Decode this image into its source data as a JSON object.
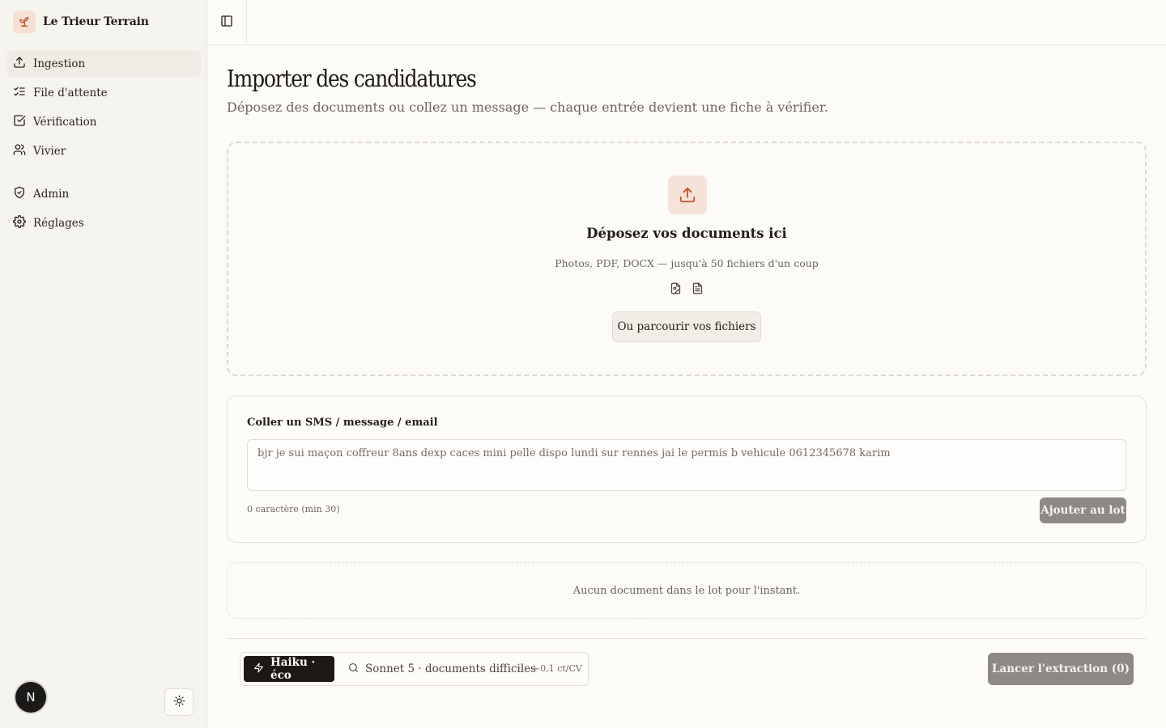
{
  "app": {
    "name": "Le Trieur Terrain",
    "accent_color": "#c2562a",
    "logo_icon": "seedling-icon"
  },
  "sidebar": {
    "items": [
      {
        "label": "Ingestion",
        "icon": "upload-icon",
        "active": true
      },
      {
        "label": "File d'attente",
        "icon": "list-checks-icon",
        "active": false
      },
      {
        "label": "Vérification",
        "icon": "check-square-icon",
        "active": false
      },
      {
        "label": "Vivier",
        "icon": "users-icon",
        "active": false
      },
      {
        "label": "Admin",
        "icon": "shield-check-icon",
        "active": false
      },
      {
        "label": "Réglages",
        "icon": "settings-icon",
        "active": false
      }
    ],
    "avatar_initial": "N",
    "theme_icon": "sun-icon"
  },
  "header": {
    "toggle_icon": "panel-left-icon"
  },
  "main": {
    "title": "Importer des candidatures",
    "subtitle": "Déposez des documents ou collez un message — chaque entrée devient une fiche à vérifier.",
    "dropzone": {
      "title": "Déposez vos documents ici",
      "hint": "Photos, PDF, DOCX — jusqu'à 50 fichiers d'un coup",
      "browse_label": "Ou parcourir vos fichiers",
      "type_icons": [
        "file-image-icon",
        "file-text-icon"
      ]
    },
    "paste": {
      "label": "Coller un SMS / message / email",
      "value": "",
      "placeholder": "bjr je sui maçon coffreur 8ans dexp caces mini pelle dispo lundi sur rennes jai le permis b vehicule 0612345678 karim",
      "char_count": "0 caractère (min 30)",
      "add_label": "Ajouter au lot"
    },
    "batch": {
      "empty_text": "Aucun document dans le lot pour l'instant."
    },
    "footer": {
      "models": [
        {
          "label": "Haiku · éco",
          "icon": "zap-icon",
          "selected": true
        },
        {
          "label": "Sonnet 5 · documents difficiles",
          "icon": "search-icon",
          "selected": false
        }
      ],
      "cost": "~0,1 ct/CV",
      "run_label": "Lancer l'extraction (0)"
    }
  }
}
